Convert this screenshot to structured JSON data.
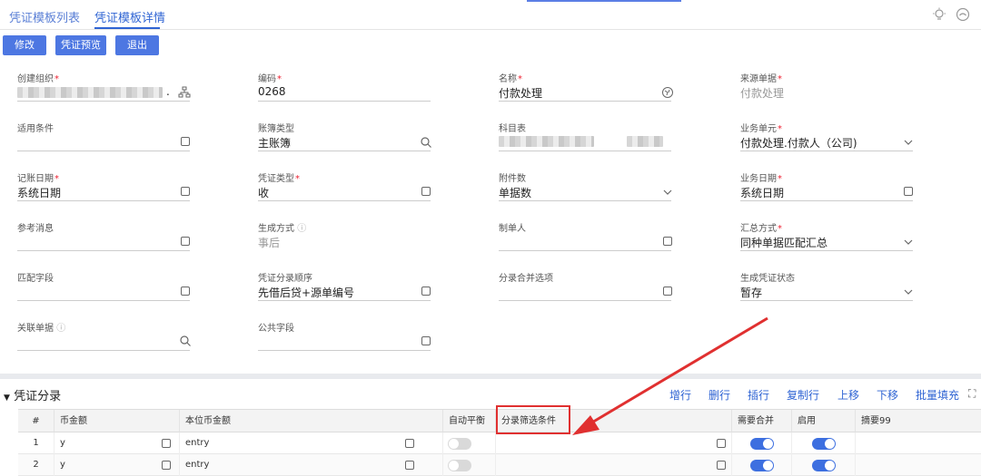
{
  "tabs": [
    {
      "label": "凭证模板列表"
    },
    {
      "label": "凭证模板详情"
    }
  ],
  "toolbar": {
    "edit_label": "修改",
    "preview_label": "凭证预览",
    "exit_label": "退出"
  },
  "form": {
    "org": {
      "label": "创建组织",
      "value": "."
    },
    "code": {
      "label": "编码",
      "value": "0268"
    },
    "name": {
      "label": "名称",
      "value": "付款处理"
    },
    "source": {
      "label": "来源单据",
      "value": "付款处理"
    },
    "condition": {
      "label": "适用条件",
      "value": ""
    },
    "book_type": {
      "label": "账簿类型",
      "value": "主账簿"
    },
    "subject_table": {
      "label": "科目表",
      "value": ""
    },
    "business_unit": {
      "label": "业务单元",
      "value": "付款处理.付款人（公司)"
    },
    "acct_date": {
      "label": "记账日期",
      "value": "系统日期"
    },
    "voucher_type": {
      "label": "凭证类型",
      "value": "收"
    },
    "attach_count": {
      "label": "附件数",
      "value": "单据数"
    },
    "biz_date": {
      "label": "业务日期",
      "value": "系统日期"
    },
    "ref_msg": {
      "label": "参考消息",
      "value": ""
    },
    "gen_mode": {
      "label": "生成方式",
      "value": "事后"
    },
    "maker": {
      "label": "制单人",
      "value": ""
    },
    "summary_mode": {
      "label": "汇总方式",
      "value": "同种单据匹配汇总"
    },
    "match_field": {
      "label": "匹配字段",
      "value": ""
    },
    "entry_order": {
      "label": "凭证分录顺序",
      "value": "先借后贷+源单编号"
    },
    "merge_option": {
      "label": "分录合并选项",
      "value": ""
    },
    "gen_status": {
      "label": "生成凭证状态",
      "value": "暂存"
    },
    "related_doc": {
      "label": "关联单据",
      "value": ""
    },
    "public_field": {
      "label": "公共字段",
      "value": ""
    }
  },
  "entries": {
    "title": "凭证分录",
    "actions": [
      "增行",
      "删行",
      "插行",
      "复制行",
      "上移",
      "下移",
      "批量填充"
    ],
    "columns": [
      "#",
      "币金额",
      "本位币金额",
      "自动平衡",
      "分录筛选条件",
      "需要合并",
      "启用",
      "摘要99"
    ],
    "rows": [
      {
        "num": "1",
        "amount": "y",
        "local_amount": "entry"
      },
      {
        "num": "2",
        "amount": "y",
        "local_amount": "entry"
      }
    ]
  }
}
